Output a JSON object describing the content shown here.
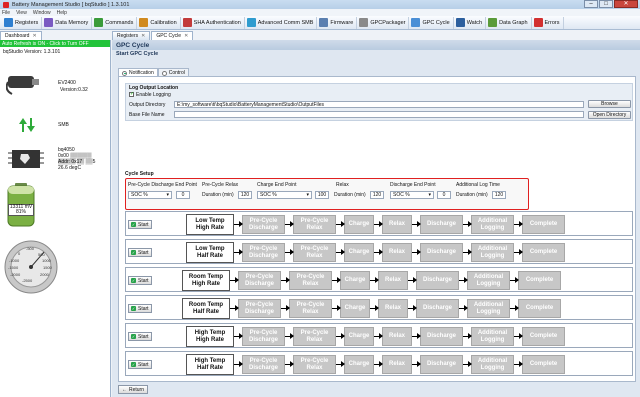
{
  "window": {
    "title": "Battery Management Studio [ bqStudio ] 1.3.101",
    "min": "–",
    "max": "□",
    "close": "✕"
  },
  "menu": [
    "File",
    "View",
    "Window",
    "Help"
  ],
  "toolbar": [
    {
      "label": "Registers",
      "icon": "registers-icon",
      "color": "#2f7fd0"
    },
    {
      "label": "Data Memory",
      "icon": "data-memory-icon",
      "color": "#7a5bc2"
    },
    {
      "label": "Commands",
      "icon": "commands-icon",
      "color": "#3a9b3a"
    },
    {
      "label": "Calibration",
      "icon": "calibration-icon",
      "color": "#d08a1f"
    },
    {
      "label": "SHA Authentication",
      "icon": "sha-icon",
      "color": "#c23b3b"
    },
    {
      "label": "Advanced Comm SMB",
      "icon": "smb-icon",
      "color": "#2f9ccf"
    },
    {
      "label": "Firmware",
      "icon": "firmware-icon",
      "color": "#5a7fb0"
    },
    {
      "label": "GPCPackager",
      "icon": "gpcpackager-icon",
      "color": "#8a8a8a"
    },
    {
      "label": "GPC Cycle",
      "icon": "gpc-cycle-icon",
      "color": "#4a8fd6"
    },
    {
      "label": "Watch",
      "icon": "watch-icon",
      "color": "#2c5f9e"
    },
    {
      "label": "Data Graph",
      "icon": "data-graph-icon",
      "color": "#5a9b3a"
    },
    {
      "label": "Errors",
      "icon": "errors-icon",
      "color": "#d23030"
    }
  ],
  "dashboard": {
    "tab": "Dashboard",
    "refresh": "Auto Refresh is ON - Click to Turn OFF",
    "version": "bqStudio Version:  1.3.101",
    "ev_name": "EV2400",
    "ev_version": "Version:0.32",
    "smb": "SMB",
    "device": "bq4050",
    "device_id": "0x00 ▒▒▒▒▒▒ ▒▒▒▒▒ ▒▒ ▒▒5",
    "addr": "Addr: 0x17",
    "temp": "26.6 degC",
    "voltage": "13311 mV",
    "percent": "81%",
    "gauge_labels": [
      "-500",
      "0",
      "500",
      "1000",
      "1500",
      "2000",
      "-1000",
      "-1500",
      "-2000",
      "-2500"
    ]
  },
  "tabs": {
    "registers": "Registers",
    "gpc": "GPC Cycle"
  },
  "main": {
    "title": "GPC Cycle",
    "subtitle": "Start GPC Cycle",
    "subtabs": [
      "Notification",
      "Control"
    ],
    "log_title": "Log Output Location",
    "enable_logging": "Enable Logging",
    "output_dir_label": "Output Directory",
    "output_dir": "E:\\my_software\\ti\\bqStudio\\BatteryManagementStudio\\OutputFiles",
    "browse": "Browse",
    "base_file_label": "Base File Name",
    "base_file": "",
    "open_dir": "Open Directory",
    "setup_title": "Cycle Setup",
    "setup": {
      "discharge_end_label": "Pre-Cycle Discharge End Point",
      "discharge_end_sel": "SOC %",
      "discharge_end_val": "0",
      "relax_label": "Pre-Cycle Relax",
      "relax_dur": "Duration (min)",
      "relax_val": "120",
      "charge_end_label": "Charge End Point",
      "charge_end_sel": "SOC %",
      "charge_end_val": "100",
      "relax2_label": "Relax",
      "relax2_dur": "Duration (min)",
      "relax2_val": "120",
      "dis_end_label": "Discharge End Point",
      "dis_end_sel": "SOC %",
      "dis_end_val": "0",
      "addlog_label": "Additional Log Time",
      "addlog_dur": "Duration (min)",
      "addlog_val": "120"
    },
    "start": "Start",
    "return": "Return",
    "cycles": [
      {
        "name": "Low Temp\nHigh Rate"
      },
      {
        "name": "Low Temp\nHalf Rate"
      },
      {
        "name": "Room Temp\nHigh Rate"
      },
      {
        "name": "Room Temp\nHalf Rate"
      },
      {
        "name": "High Temp\nHigh Rate"
      },
      {
        "name": "High Temp\nHalf Rate"
      }
    ],
    "steps": [
      "Pre-Cycle\nDischarge",
      "Pre-Cycle\nRelax",
      "Charge",
      "Relax",
      "Discharge",
      "Additional\nLogging",
      "Complete"
    ]
  }
}
